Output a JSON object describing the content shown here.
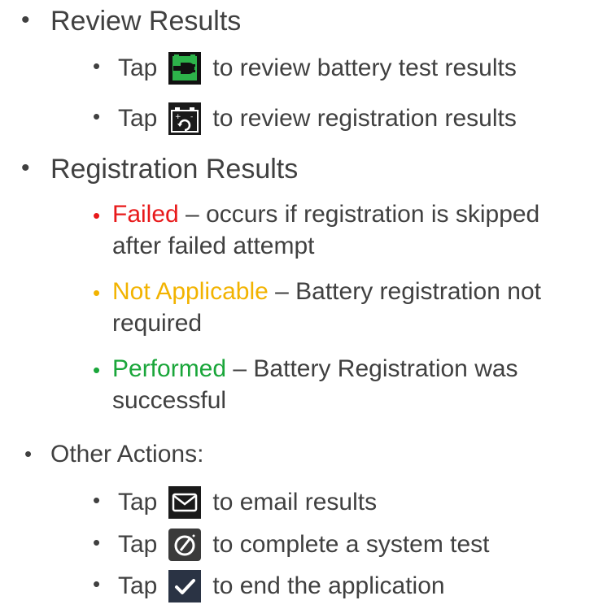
{
  "bullet_char": "•",
  "sections": {
    "review": {
      "heading": "Review Results",
      "items": [
        {
          "prefix": "Tap",
          "icon": "battery-plug-icon",
          "text": "to review battery test results"
        },
        {
          "prefix": "Tap",
          "icon": "battery-registration-icon",
          "text": "to review registration results"
        }
      ]
    },
    "registration": {
      "heading": "Registration Results",
      "items": [
        {
          "term": "Failed",
          "rest": " – occurs if registration is skipped",
          "rest2": "after failed attempt",
          "color": "#e8191a"
        },
        {
          "term": "Not Applicable",
          "rest": " – Battery registration not",
          "rest2": "required",
          "color": "#f2b300"
        },
        {
          "term": "Performed",
          "rest": " – Battery Registration was",
          "rest2": "successful",
          "color": "#1aa63a"
        }
      ]
    },
    "other": {
      "heading": "Other Actions:",
      "items": [
        {
          "prefix": "Tap",
          "icon": "email-icon",
          "text": "to email results"
        },
        {
          "prefix": "Tap",
          "icon": "system-test-icon",
          "text": "to complete a system test"
        },
        {
          "prefix": "Tap",
          "icon": "checkmark-icon",
          "text": "to end the application"
        }
      ]
    }
  }
}
